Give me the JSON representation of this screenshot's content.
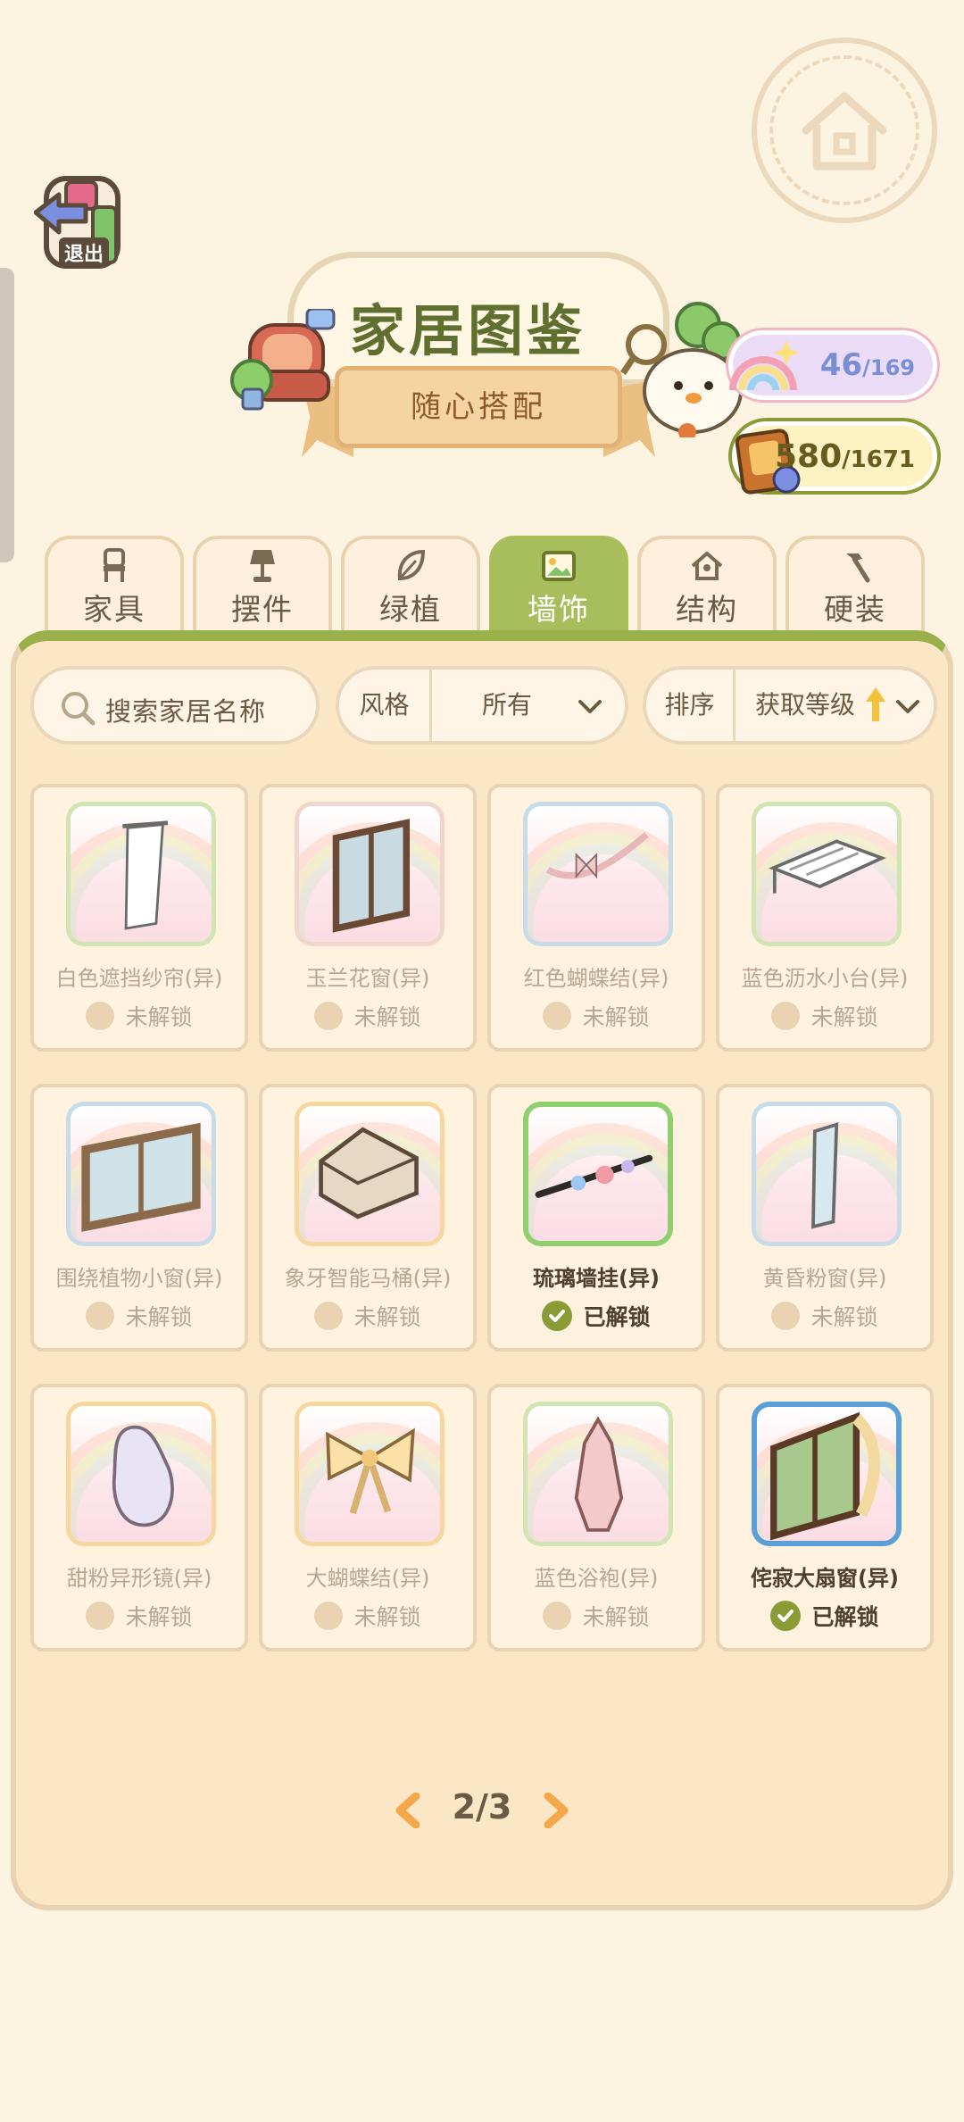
{
  "header": {
    "exit_label": "退出",
    "title": "家居图鉴",
    "subtitle": "随心搭配"
  },
  "counters": {
    "rainbow": {
      "value": "46",
      "total": "/169"
    },
    "book": {
      "value": "580",
      "total": "/1671"
    }
  },
  "tabs": [
    {
      "label": "家具",
      "icon": "chair-icon",
      "active": false
    },
    {
      "label": "摆件",
      "icon": "lamp-icon",
      "active": false
    },
    {
      "label": "绿植",
      "icon": "leaf-icon",
      "active": false
    },
    {
      "label": "墙饰",
      "icon": "picture-icon",
      "active": true
    },
    {
      "label": "结构",
      "icon": "house-icon",
      "active": false
    },
    {
      "label": "硬装",
      "icon": "hammer-icon",
      "active": false
    }
  ],
  "filters": {
    "search_placeholder": "搜索家居名称",
    "style_label": "风格",
    "style_value": "所有",
    "sort_label": "排序",
    "sort_value": "获取等级"
  },
  "items": [
    {
      "name": "白色遮挡纱帘(异)",
      "status": "未解锁",
      "unlocked": false
    },
    {
      "name": "玉兰花窗(异)",
      "status": "未解锁",
      "unlocked": false
    },
    {
      "name": "红色蝴蝶结(异)",
      "status": "未解锁",
      "unlocked": false
    },
    {
      "name": "蓝色沥水小台(异)",
      "status": "未解锁",
      "unlocked": false
    },
    {
      "name": "围绕植物小窗(异)",
      "status": "未解锁",
      "unlocked": false
    },
    {
      "name": "象牙智能马桶(异)",
      "status": "未解锁",
      "unlocked": false
    },
    {
      "name": "琉璃墙挂(异)",
      "status": "已解锁",
      "unlocked": true
    },
    {
      "name": "黄昏粉窗(异)",
      "status": "未解锁",
      "unlocked": false
    },
    {
      "name": "甜粉异形镜(异)",
      "status": "未解锁",
      "unlocked": false
    },
    {
      "name": "大蝴蝶结(异)",
      "status": "未解锁",
      "unlocked": false
    },
    {
      "name": "蓝色浴袍(异)",
      "status": "未解锁",
      "unlocked": false
    },
    {
      "name": "侘寂大扇窗(异)",
      "status": "已解锁",
      "unlocked": true
    }
  ],
  "pagination": {
    "label": "2/3"
  }
}
